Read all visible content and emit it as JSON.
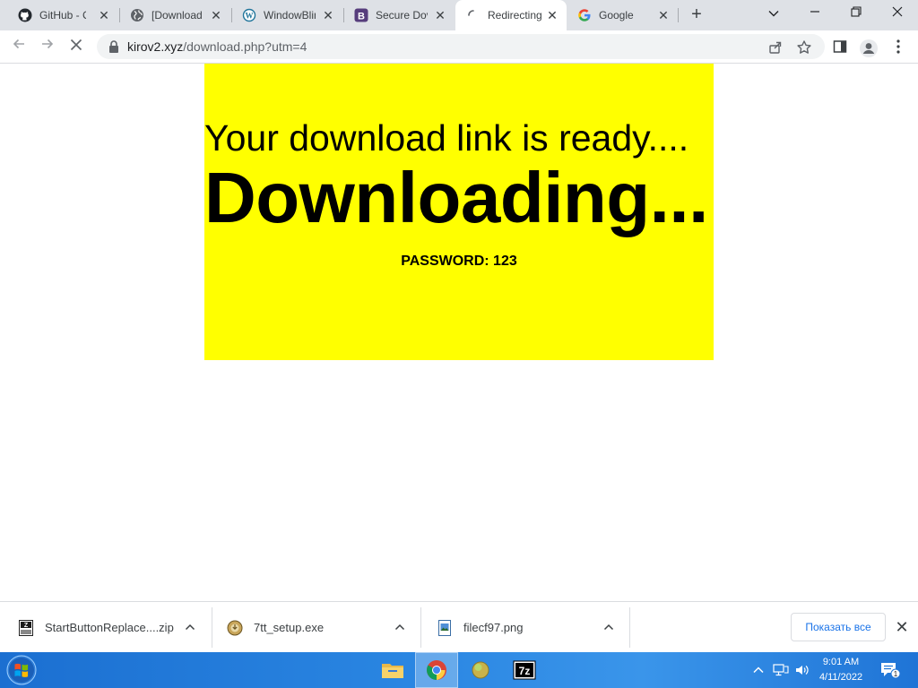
{
  "browser": {
    "tabs": [
      {
        "title": "GitHub - Ca",
        "icon": "github-icon"
      },
      {
        "title": "[Download",
        "icon": "globe-icon"
      },
      {
        "title": "WindowBlin",
        "icon": "wordpress-icon"
      },
      {
        "title": "Secure Dov",
        "icon": "bootstrap-icon"
      },
      {
        "title": "Redirecting",
        "icon": "loading-spinner-icon"
      },
      {
        "title": "Google",
        "icon": "google-icon"
      }
    ],
    "active_tab_index": 4,
    "new_tab_label": "+",
    "url_host": "kirov2.xyz",
    "url_path": "/download.php?utm=4"
  },
  "page": {
    "heading_ready": "Your download link is ready....",
    "heading_downloading": "Downloading...",
    "password_text": "PASSWORD: 123",
    "box_color": "#ffff00"
  },
  "downloads": {
    "items": [
      {
        "name": "StartButtonReplace....zip",
        "icon": "zip-archive-icon"
      },
      {
        "name": "7tt_setup.exe",
        "icon": "installer-icon"
      },
      {
        "name": "filecf97.png",
        "icon": "image-file-icon"
      }
    ],
    "show_all_label": "Показать все",
    "close_label": "✕"
  },
  "taskbar": {
    "apps": [
      {
        "name": "file-explorer-icon",
        "active": false
      },
      {
        "name": "chrome-icon",
        "active": true
      },
      {
        "name": "app-orb-icon",
        "active": false
      },
      {
        "name": "7zip-icon",
        "active": false
      }
    ],
    "clock_time": "9:01 AM",
    "clock_date": "4/11/2022",
    "notification_count": "1"
  }
}
